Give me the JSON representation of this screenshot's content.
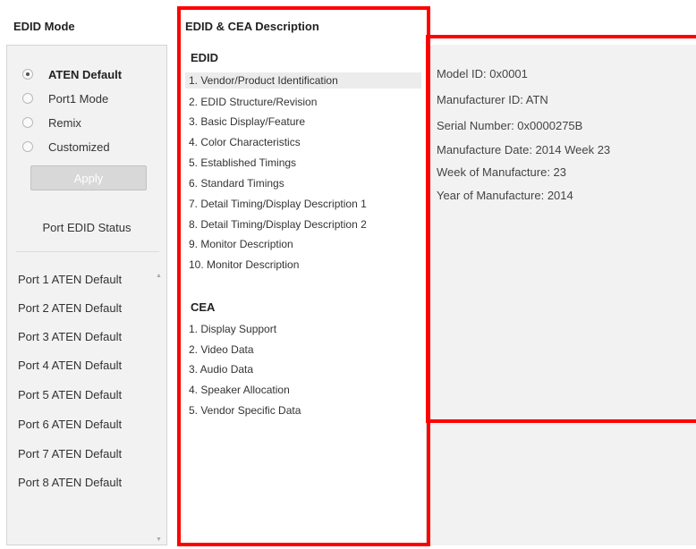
{
  "left": {
    "title": "EDID Mode",
    "modes": [
      {
        "label": "ATEN Default",
        "checked": true
      },
      {
        "label": "Port1 Mode",
        "checked": false
      },
      {
        "label": "Remix",
        "checked": false
      },
      {
        "label": "Customized",
        "checked": false
      }
    ],
    "apply_label": "Apply",
    "port_status_title": "Port EDID Status",
    "ports": [
      "Port 1  ATEN Default",
      "Port 2  ATEN Default",
      "Port 3  ATEN Default",
      "Port 4  ATEN Default",
      "Port 5  ATEN Default",
      "Port 6  ATEN Default",
      "Port 7  ATEN Default",
      "Port 8  ATEN Default"
    ]
  },
  "middle": {
    "title": "EDID & CEA Description",
    "edid_heading": "EDID",
    "edid_items": [
      "1.  Vendor/Product Identification",
      "2.  EDID Structure/Revision",
      "3.  Basic Display/Feature",
      "4.  Color Characteristics",
      "5.  Established Timings",
      "6.  Standard Timings",
      "7.  Detail Timing/Display Description 1",
      "8.  Detail Timing/Display Description 2",
      "9.  Monitor Description",
      "10.  Monitor Description"
    ],
    "cea_heading": "CEA",
    "cea_items": [
      "1.  Display Support",
      "2.  Video Data",
      "3.  Audio Data",
      "4.  Speaker Allocation",
      "5.  Vendor Specific Data"
    ]
  },
  "right": {
    "lines": [
      "Model ID: 0x0001",
      "Manufacturer ID: ATN",
      "Serial Number: 0x0000275B",
      "Manufacture Date: 2014 Week 23",
      "Week of Manufacture: 23",
      "Year of Manufacture: 2014"
    ]
  },
  "colors": {
    "highlight": "#ff0000",
    "panel_bg": "#f2f2f2",
    "selected_row": "#ececec"
  },
  "icons": {
    "scroll_up": "scroll-up-arrow-icon",
    "scroll_down": "scroll-down-arrow-icon"
  }
}
